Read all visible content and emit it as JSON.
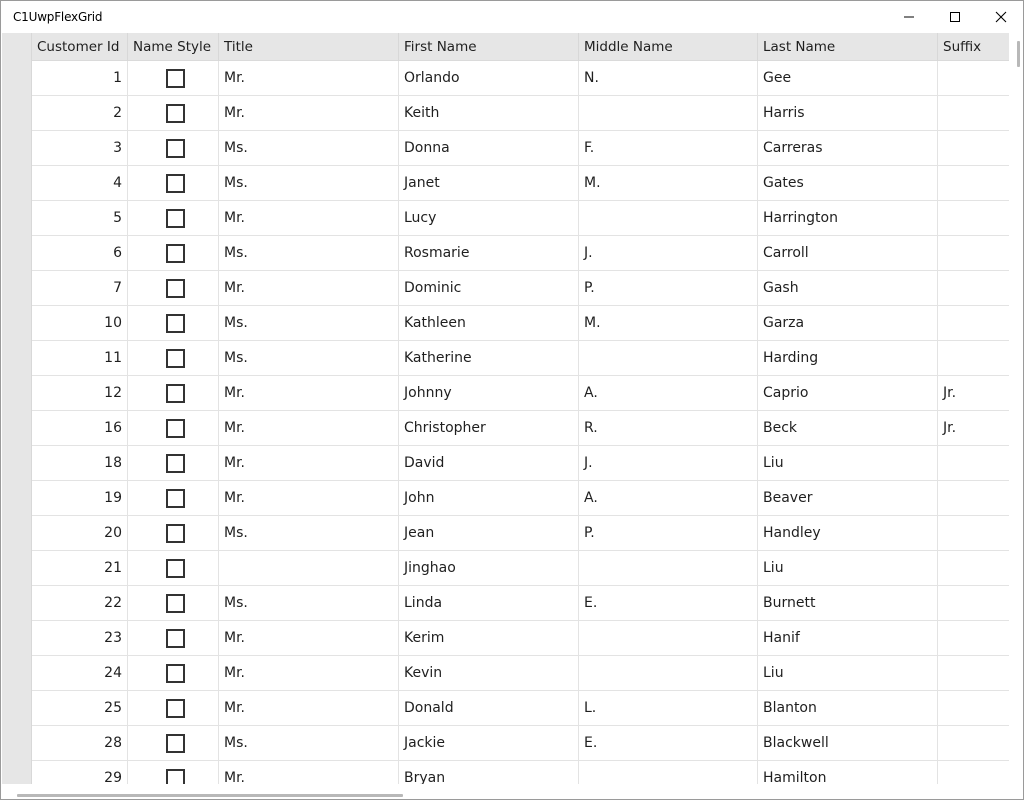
{
  "window": {
    "title": "C1UwpFlexGrid"
  },
  "grid": {
    "columns": [
      "Customer Id",
      "Name Style",
      "Title",
      "First Name",
      "Middle Name",
      "Last Name",
      "Suffix"
    ],
    "rows": [
      {
        "id": "1",
        "title": "Mr.",
        "first": "Orlando",
        "middle": "N.",
        "last": "Gee",
        "suffix": ""
      },
      {
        "id": "2",
        "title": "Mr.",
        "first": "Keith",
        "middle": "",
        "last": "Harris",
        "suffix": ""
      },
      {
        "id": "3",
        "title": "Ms.",
        "first": "Donna",
        "middle": "F.",
        "last": "Carreras",
        "suffix": ""
      },
      {
        "id": "4",
        "title": "Ms.",
        "first": "Janet",
        "middle": "M.",
        "last": "Gates",
        "suffix": ""
      },
      {
        "id": "5",
        "title": "Mr.",
        "first": "Lucy",
        "middle": "",
        "last": "Harrington",
        "suffix": ""
      },
      {
        "id": "6",
        "title": "Ms.",
        "first": "Rosmarie",
        "middle": "J.",
        "last": "Carroll",
        "suffix": ""
      },
      {
        "id": "7",
        "title": "Mr.",
        "first": "Dominic",
        "middle": "P.",
        "last": "Gash",
        "suffix": ""
      },
      {
        "id": "10",
        "title": "Ms.",
        "first": "Kathleen",
        "middle": "M.",
        "last": "Garza",
        "suffix": ""
      },
      {
        "id": "11",
        "title": "Ms.",
        "first": "Katherine",
        "middle": "",
        "last": "Harding",
        "suffix": ""
      },
      {
        "id": "12",
        "title": "Mr.",
        "first": "Johnny",
        "middle": "A.",
        "last": "Caprio",
        "suffix": "Jr."
      },
      {
        "id": "16",
        "title": "Mr.",
        "first": "Christopher",
        "middle": "R.",
        "last": "Beck",
        "suffix": "Jr."
      },
      {
        "id": "18",
        "title": "Mr.",
        "first": "David",
        "middle": "J.",
        "last": "Liu",
        "suffix": ""
      },
      {
        "id": "19",
        "title": "Mr.",
        "first": "John",
        "middle": "A.",
        "last": "Beaver",
        "suffix": ""
      },
      {
        "id": "20",
        "title": "Ms.",
        "first": "Jean",
        "middle": "P.",
        "last": "Handley",
        "suffix": ""
      },
      {
        "id": "21",
        "title": "",
        "first": "Jinghao",
        "middle": "",
        "last": "Liu",
        "suffix": ""
      },
      {
        "id": "22",
        "title": "Ms.",
        "first": "Linda",
        "middle": "E.",
        "last": "Burnett",
        "suffix": ""
      },
      {
        "id": "23",
        "title": "Mr.",
        "first": "Kerim",
        "middle": "",
        "last": "Hanif",
        "suffix": ""
      },
      {
        "id": "24",
        "title": "Mr.",
        "first": "Kevin",
        "middle": "",
        "last": "Liu",
        "suffix": ""
      },
      {
        "id": "25",
        "title": "Mr.",
        "first": "Donald",
        "middle": "L.",
        "last": "Blanton",
        "suffix": ""
      },
      {
        "id": "28",
        "title": "Ms.",
        "first": "Jackie",
        "middle": "E.",
        "last": "Blackwell",
        "suffix": ""
      },
      {
        "id": "29",
        "title": "Mr.",
        "first": "Bryan",
        "middle": "",
        "last": "Hamilton",
        "suffix": ""
      }
    ]
  }
}
